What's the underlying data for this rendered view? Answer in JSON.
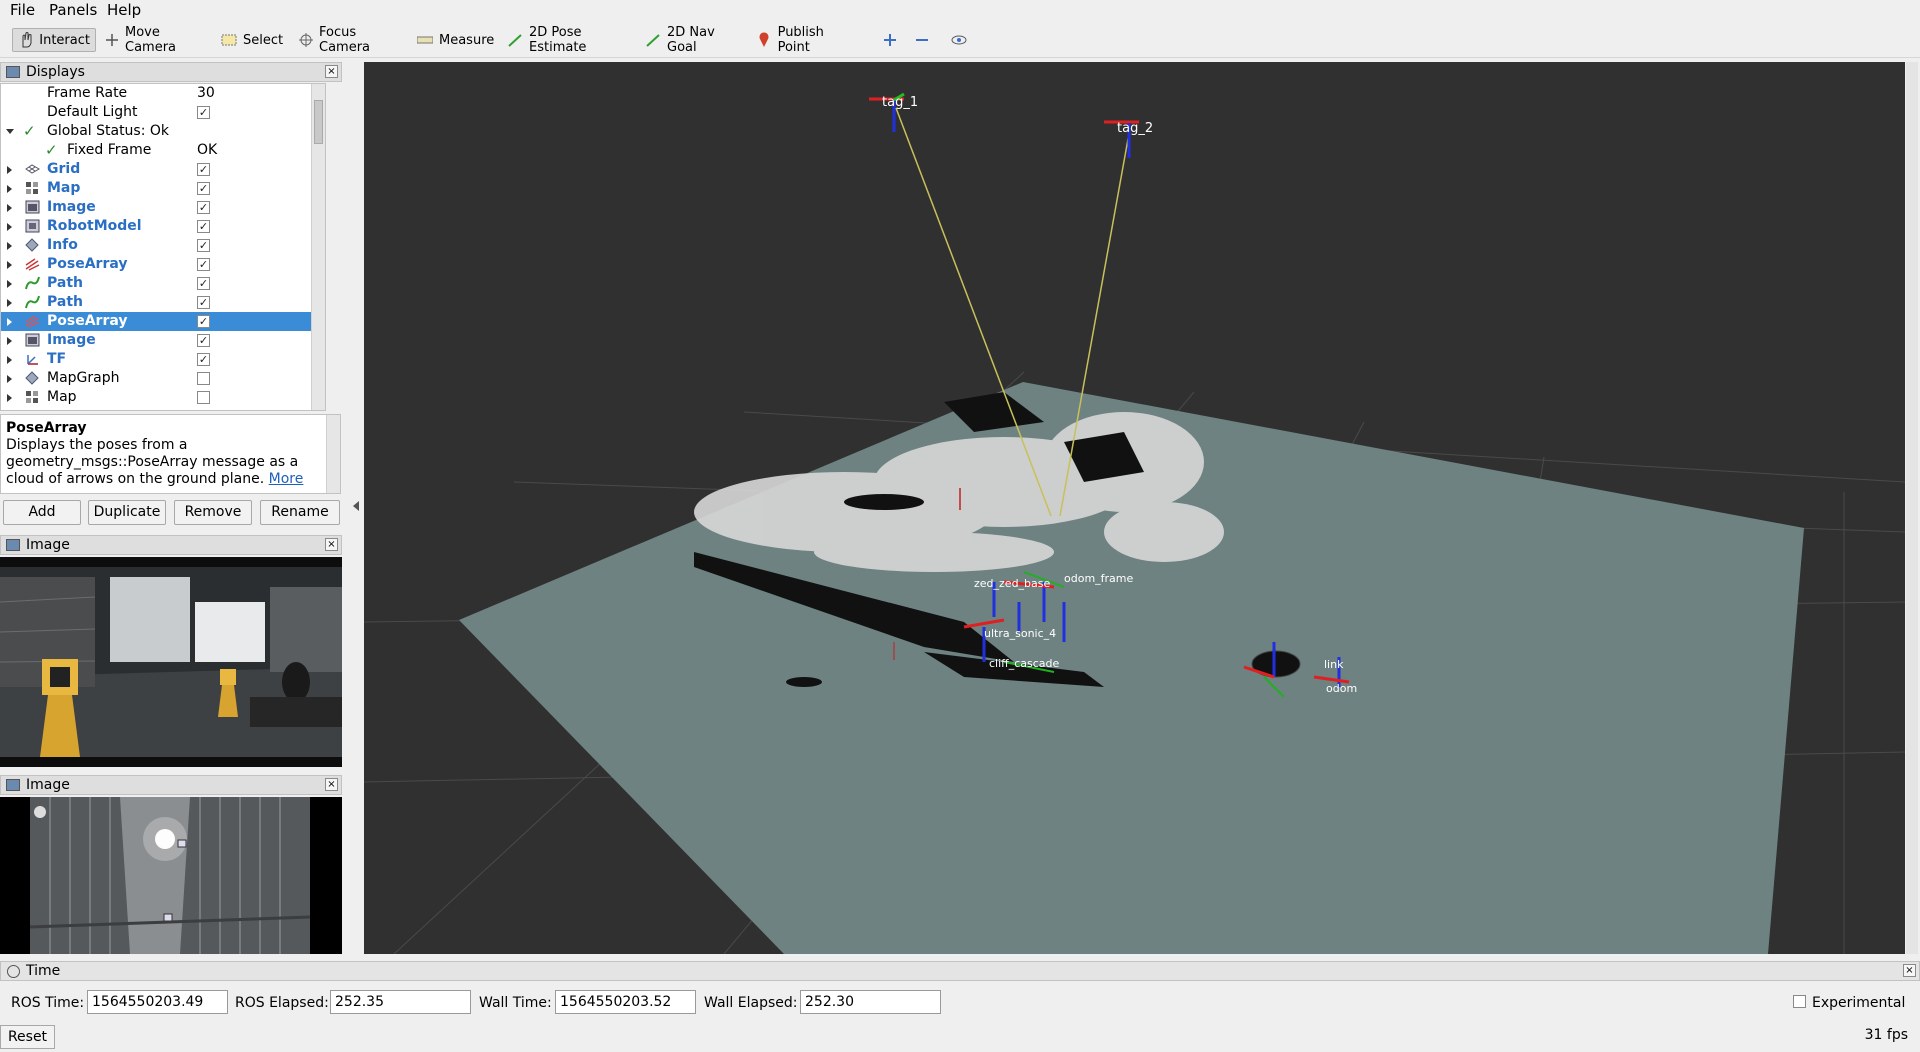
{
  "menu": {
    "file": "File",
    "panels": "Panels",
    "help": "Help"
  },
  "toolbar": {
    "interact": "Interact",
    "move_camera": "Move Camera",
    "select": "Select",
    "focus_camera": "Focus Camera",
    "measure": "Measure",
    "pose_estimate": "2D Pose Estimate",
    "nav_goal": "2D Nav Goal",
    "publish_point": "Publish Point"
  },
  "displays": {
    "title": "Displays",
    "rows": [
      {
        "label": "Frame Rate",
        "value": "30"
      },
      {
        "label": "Default Light",
        "checked": true
      },
      {
        "label": "Global Status: Ok"
      },
      {
        "label": "Fixed Frame",
        "value": "OK"
      },
      {
        "label": "Grid",
        "checked": true
      },
      {
        "label": "Map",
        "checked": true
      },
      {
        "label": "Image",
        "checked": true
      },
      {
        "label": "RobotModel",
        "checked": true
      },
      {
        "label": "Info",
        "checked": true
      },
      {
        "label": "PoseArray",
        "checked": true
      },
      {
        "label": "Path",
        "checked": true
      },
      {
        "label": "Path",
        "checked": true
      },
      {
        "label": "PoseArray",
        "checked": true,
        "selected": true
      },
      {
        "label": "Image",
        "checked": true
      },
      {
        "label": "TF",
        "checked": true
      },
      {
        "label": "MapGraph",
        "checked": false
      },
      {
        "label": "Map",
        "checked": false
      }
    ],
    "check_mark": "✓"
  },
  "description": {
    "title": "PoseArray",
    "text": "Displays the poses from a geometry_msgs::PoseArray message as a cloud of arrows on the ground plane.",
    "more": "More"
  },
  "buttons": {
    "add": "Add",
    "duplicate": "Duplicate",
    "remove": "Remove",
    "rename": "Rename"
  },
  "image_panel_1": {
    "title": "Image"
  },
  "image_panel_2": {
    "title": "Image"
  },
  "viewport": {
    "tag1": "tag_1",
    "tag2": "tag_2"
  },
  "time_panel": {
    "title": "Time",
    "ros_time_label": "ROS Time:",
    "ros_time": "1564550203.49",
    "ros_elapsed_label": "ROS Elapsed:",
    "ros_elapsed": "252.35",
    "wall_time_label": "Wall Time:",
    "wall_time": "1564550203.52",
    "wall_elapsed_label": "Wall Elapsed:",
    "wall_elapsed": "252.30",
    "experimental": "Experimental",
    "reset": "Reset",
    "fps": "31 fps"
  },
  "colors": {
    "selection": "#3a8cd6",
    "link_blue": "#2a6fc4",
    "viewport_bg": "#303030",
    "ground": "#6e8282"
  }
}
